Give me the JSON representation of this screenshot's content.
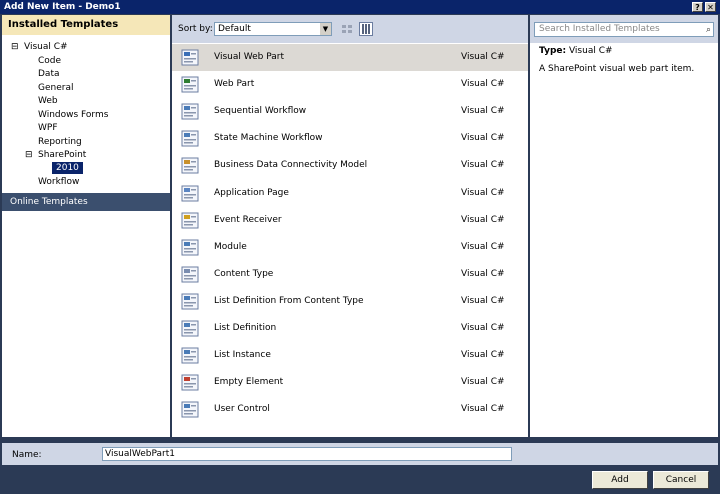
{
  "window": {
    "title": "Add New Item - Demo1",
    "help_glyph": "?",
    "close_glyph": "✕"
  },
  "left": {
    "header": "Installed Templates",
    "tree": [
      {
        "label": "Visual C#",
        "expander": "⊟"
      },
      {
        "label": "Code"
      },
      {
        "label": "Data"
      },
      {
        "label": "General"
      },
      {
        "label": "Web"
      },
      {
        "label": "Windows Forms"
      },
      {
        "label": "WPF"
      },
      {
        "label": "Reporting"
      },
      {
        "label": "SharePoint",
        "expander": "⊟"
      },
      {
        "label": "2010",
        "selected": true
      },
      {
        "label": "Workflow"
      }
    ],
    "online": "Online Templates"
  },
  "toolbar": {
    "sort_label": "Sort by:",
    "sort_value": "Default",
    "dropdown_arrow": "▼"
  },
  "search": {
    "placeholder": "Search Installed Templates",
    "icon": "search-icon",
    "glyph": "⌕"
  },
  "templates": [
    {
      "name": "Visual Web Part",
      "lang": "Visual C#",
      "icon": "visual-web-part-icon",
      "selected": true
    },
    {
      "name": "Web Part",
      "lang": "Visual C#",
      "icon": "web-part-icon"
    },
    {
      "name": "Sequential Workflow",
      "lang": "Visual C#",
      "icon": "sequential-workflow-icon"
    },
    {
      "name": "State Machine Workflow",
      "lang": "Visual C#",
      "icon": "state-machine-workflow-icon"
    },
    {
      "name": "Business Data Connectivity Model",
      "lang": "Visual C#",
      "icon": "bdc-model-icon"
    },
    {
      "name": "Application Page",
      "lang": "Visual C#",
      "icon": "application-page-icon"
    },
    {
      "name": "Event Receiver",
      "lang": "Visual C#",
      "icon": "event-receiver-icon"
    },
    {
      "name": "Module",
      "lang": "Visual C#",
      "icon": "module-icon"
    },
    {
      "name": "Content Type",
      "lang": "Visual C#",
      "icon": "content-type-icon"
    },
    {
      "name": "List Definition From Content Type",
      "lang": "Visual C#",
      "icon": "list-definition-ct-icon"
    },
    {
      "name": "List Definition",
      "lang": "Visual C#",
      "icon": "list-definition-icon"
    },
    {
      "name": "List Instance",
      "lang": "Visual C#",
      "icon": "list-instance-icon"
    },
    {
      "name": "Empty Element",
      "lang": "Visual C#",
      "icon": "empty-element-icon"
    },
    {
      "name": "User Control",
      "lang": "Visual C#",
      "icon": "user-control-icon"
    }
  ],
  "details": {
    "type_label": "Type:",
    "type_value": "Visual C#",
    "description": "A SharePoint visual web part item."
  },
  "namebar": {
    "label": "Name:",
    "value": "VisualWebPart1"
  },
  "buttons": {
    "add": "Add",
    "cancel": "Cancel"
  },
  "colors": {
    "accent": "#0a246a",
    "header_bg": "#f5e7b8",
    "panel_bg": "#cfd6e5"
  }
}
